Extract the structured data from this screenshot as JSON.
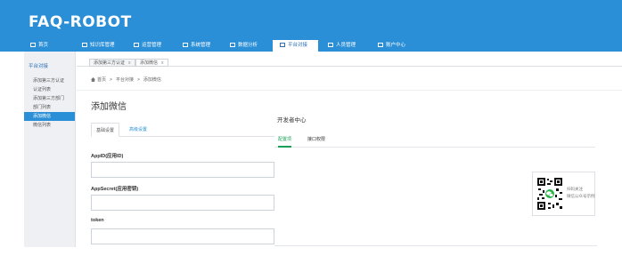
{
  "brand": {
    "logo": "FAQ-ROBOT"
  },
  "nav": {
    "items": [
      {
        "label": "首页",
        "icon": "home-icon"
      },
      {
        "label": "知识库管理",
        "icon": "book-icon"
      },
      {
        "label": "运营管理",
        "icon": "calendar-icon"
      },
      {
        "label": "系统管理",
        "icon": "monitor-icon"
      },
      {
        "label": "数据分析",
        "icon": "chart-icon"
      },
      {
        "label": "平台对接",
        "icon": "plug-icon",
        "active": true
      },
      {
        "label": "人员管理",
        "icon": "user-icon"
      },
      {
        "label": "账户中心",
        "icon": "account-icon"
      }
    ]
  },
  "sidebar": {
    "header": "平台对接",
    "items": [
      {
        "label": "添加第三方认证"
      },
      {
        "label": "认证列表"
      },
      {
        "label": "添加第三方部门"
      },
      {
        "label": "部门列表"
      },
      {
        "label": "添加微信",
        "active": true
      },
      {
        "label": "微信列表"
      }
    ]
  },
  "tabs": {
    "items": [
      {
        "label": "添加第三方认证",
        "close": "x"
      },
      {
        "label": "添加微信",
        "close": "x",
        "active": true
      }
    ]
  },
  "breadcrumb": {
    "home": "首页",
    "sep": ">",
    "level1": "平台对接",
    "level2": "添加微信"
  },
  "page": {
    "title": "添加微信"
  },
  "form_tabs": {
    "basic": "基础设置",
    "advanced": "高级设置"
  },
  "fields": {
    "appid": {
      "label": "AppID(应用ID)",
      "value": ""
    },
    "appsecret": {
      "label": "AppSecret(应用密钥)",
      "value": ""
    },
    "token": {
      "label": "token",
      "value": ""
    }
  },
  "developer": {
    "title": "开发者中心",
    "tabs": [
      "配置项",
      "接口权限"
    ]
  },
  "qr": {
    "line1": "扫码关注",
    "line2": "微信公众号示例"
  },
  "colors": {
    "primary": "#2a8fd6",
    "active_tab": "#18a058"
  }
}
